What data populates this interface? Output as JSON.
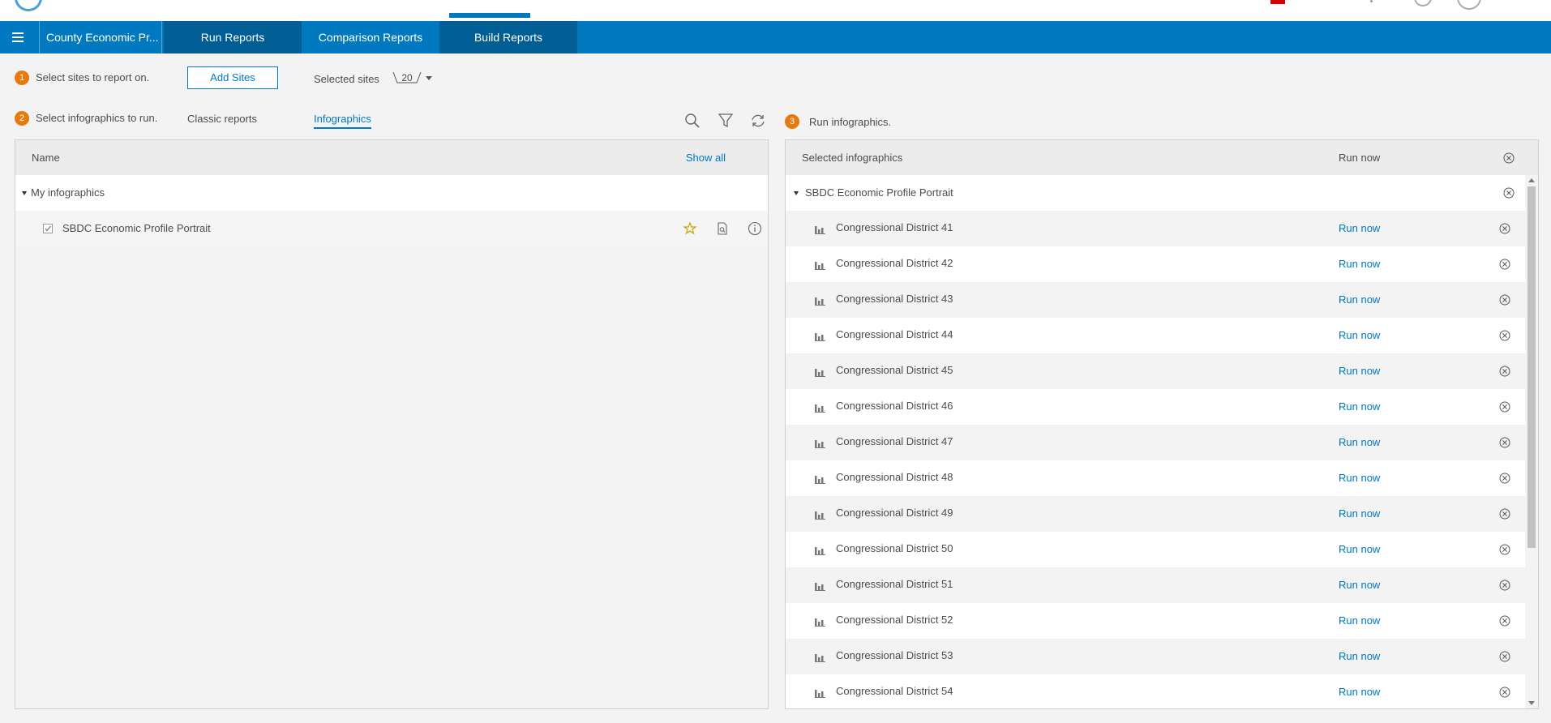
{
  "nav": {
    "project_title": "County Economic Pr...",
    "tabs": [
      {
        "label": "Run Reports"
      },
      {
        "label": "Comparison Reports"
      },
      {
        "label": "Build Reports"
      }
    ]
  },
  "step1": {
    "number": "1",
    "text": "Select sites to report on.",
    "add_sites_label": "Add Sites",
    "selected_sites_label": "Selected sites",
    "selected_sites_count": "20"
  },
  "step2": {
    "number": "2",
    "text": "Select infographics to run.",
    "tabs": [
      {
        "label": "Classic reports"
      },
      {
        "label": "Infographics"
      }
    ]
  },
  "step3": {
    "number": "3",
    "text": "Run infographics."
  },
  "left_panel": {
    "column_name": "Name",
    "show_all": "Show all",
    "group_label": "My infographics",
    "item_label": "SBDC Economic Profile Portrait"
  },
  "right_panel": {
    "column_selected": "Selected infographics",
    "column_run": "Run now",
    "group_label": "SBDC Economic Profile Portrait",
    "run_label": "Run now",
    "rows": [
      "Congressional District 41",
      "Congressional District 42",
      "Congressional District 43",
      "Congressional District 44",
      "Congressional District 45",
      "Congressional District 46",
      "Congressional District 47",
      "Congressional District 48",
      "Congressional District 49",
      "Congressional District 50",
      "Congressional District 51",
      "Congressional District 52",
      "Congressional District 53",
      "Congressional District 54"
    ]
  },
  "icons": {
    "search": "search-icon",
    "filter": "filter-icon",
    "refresh": "refresh-icon",
    "favorite": "star-icon",
    "preview": "document-preview-icon",
    "info": "info-icon",
    "remove": "close-circle-icon",
    "chart": "bar-chart-icon"
  },
  "colors": {
    "brand_blue": "#0079c1",
    "dark_tab": "#005e95",
    "step_orange": "#e8790c",
    "favorite_star": "#e8c10c"
  }
}
